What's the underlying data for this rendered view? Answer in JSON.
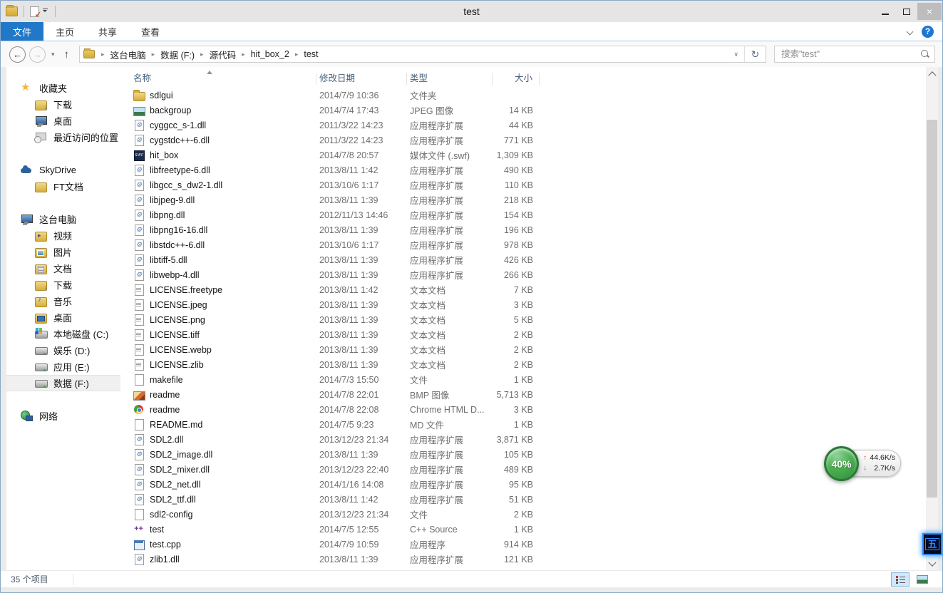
{
  "window": {
    "title": "test"
  },
  "icons": {
    "back": "←",
    "up": "↑",
    "refresh": "↻",
    "close": "×",
    "help": "?"
  },
  "ribbon": {
    "tabs": [
      {
        "key": "file",
        "label": "文件",
        "active": true
      },
      {
        "key": "home",
        "label": "主页",
        "active": false
      },
      {
        "key": "share",
        "label": "共享",
        "active": false
      },
      {
        "key": "view",
        "label": "查看",
        "active": false
      }
    ]
  },
  "address": {
    "breadcrumb": [
      "这台电脑",
      "数据 (F:)",
      "源代码",
      "hit_box_2",
      "test"
    ],
    "search_placeholder": "搜索\"test\""
  },
  "sidebar": {
    "groups": [
      {
        "key": "favorites",
        "label": "收藏夹",
        "icon": "star",
        "items": [
          {
            "label": "下载",
            "icon": "folder-down"
          },
          {
            "label": "桌面",
            "icon": "monitor"
          },
          {
            "label": "最近访问的位置",
            "icon": "recent"
          }
        ]
      },
      {
        "key": "skydrive",
        "label": "SkyDrive",
        "icon": "cloud",
        "items": [
          {
            "label": "FT文档",
            "icon": "folder"
          }
        ]
      },
      {
        "key": "thispc",
        "label": "这台电脑",
        "icon": "monitor",
        "items": [
          {
            "label": "视频",
            "icon": "folder-vid"
          },
          {
            "label": "图片",
            "icon": "folder-pic"
          },
          {
            "label": "文档",
            "icon": "folder-doc"
          },
          {
            "label": "下载",
            "icon": "folder-down"
          },
          {
            "label": "音乐",
            "icon": "folder-mus"
          },
          {
            "label": "桌面",
            "icon": "folder-desk"
          },
          {
            "label": "本地磁盘 (C:)",
            "icon": "disk-c"
          },
          {
            "label": "娱乐 (D:)",
            "icon": "disk"
          },
          {
            "label": "应用 (E:)",
            "icon": "disk"
          },
          {
            "label": "数据 (F:)",
            "icon": "disk",
            "selected": true
          }
        ]
      },
      {
        "key": "network",
        "label": "网络",
        "icon": "network",
        "items": []
      }
    ]
  },
  "filelist": {
    "columns": [
      {
        "key": "name",
        "label": "名称",
        "sorted": "asc"
      },
      {
        "key": "date",
        "label": "修改日期"
      },
      {
        "key": "type",
        "label": "类型"
      },
      {
        "key": "size",
        "label": "大小"
      }
    ],
    "rows": [
      {
        "name": "sdlgui",
        "date": "2014/7/9 10:36",
        "type": "文件夹",
        "size": "",
        "icon": "folder"
      },
      {
        "name": "backgroup",
        "date": "2014/7/4 17:43",
        "type": "JPEG 图像",
        "size": "14 KB",
        "icon": "jpeg"
      },
      {
        "name": "cyggcc_s-1.dll",
        "date": "2011/3/22 14:23",
        "type": "应用程序扩展",
        "size": "44 KB",
        "icon": "dll"
      },
      {
        "name": "cygstdc++-6.dll",
        "date": "2011/3/22 14:23",
        "type": "应用程序扩展",
        "size": "771 KB",
        "icon": "dll"
      },
      {
        "name": "hit_box",
        "date": "2014/7/8 20:57",
        "type": "媒体文件 (.swf)",
        "size": "1,309 KB",
        "icon": "swf"
      },
      {
        "name": "libfreetype-6.dll",
        "date": "2013/8/11 1:42",
        "type": "应用程序扩展",
        "size": "490 KB",
        "icon": "dll"
      },
      {
        "name": "libgcc_s_dw2-1.dll",
        "date": "2013/10/6 1:17",
        "type": "应用程序扩展",
        "size": "110 KB",
        "icon": "dll"
      },
      {
        "name": "libjpeg-9.dll",
        "date": "2013/8/11 1:39",
        "type": "应用程序扩展",
        "size": "218 KB",
        "icon": "dll"
      },
      {
        "name": "libpng.dll",
        "date": "2012/11/13 14:46",
        "type": "应用程序扩展",
        "size": "154 KB",
        "icon": "dll"
      },
      {
        "name": "libpng16-16.dll",
        "date": "2013/8/11 1:39",
        "type": "应用程序扩展",
        "size": "196 KB",
        "icon": "dll"
      },
      {
        "name": "libstdc++-6.dll",
        "date": "2013/10/6 1:17",
        "type": "应用程序扩展",
        "size": "978 KB",
        "icon": "dll"
      },
      {
        "name": "libtiff-5.dll",
        "date": "2013/8/11 1:39",
        "type": "应用程序扩展",
        "size": "426 KB",
        "icon": "dll"
      },
      {
        "name": "libwebp-4.dll",
        "date": "2013/8/11 1:39",
        "type": "应用程序扩展",
        "size": "266 KB",
        "icon": "dll"
      },
      {
        "name": "LICENSE.freetype",
        "date": "2013/8/11 1:42",
        "type": "文本文档",
        "size": "7 KB",
        "icon": "txt"
      },
      {
        "name": "LICENSE.jpeg",
        "date": "2013/8/11 1:39",
        "type": "文本文档",
        "size": "3 KB",
        "icon": "txt"
      },
      {
        "name": "LICENSE.png",
        "date": "2013/8/11 1:39",
        "type": "文本文档",
        "size": "5 KB",
        "icon": "txt"
      },
      {
        "name": "LICENSE.tiff",
        "date": "2013/8/11 1:39",
        "type": "文本文档",
        "size": "2 KB",
        "icon": "txt"
      },
      {
        "name": "LICENSE.webp",
        "date": "2013/8/11 1:39",
        "type": "文本文档",
        "size": "2 KB",
        "icon": "txt"
      },
      {
        "name": "LICENSE.zlib",
        "date": "2013/8/11 1:39",
        "type": "文本文档",
        "size": "2 KB",
        "icon": "txt"
      },
      {
        "name": "makefile",
        "date": "2014/7/3 15:50",
        "type": "文件",
        "size": "1 KB",
        "icon": "file"
      },
      {
        "name": "readme",
        "date": "2014/7/8 22:01",
        "type": "BMP 图像",
        "size": "5,713 KB",
        "icon": "bmp"
      },
      {
        "name": "readme",
        "date": "2014/7/8 22:08",
        "type": "Chrome HTML D...",
        "size": "3 KB",
        "icon": "chrome"
      },
      {
        "name": "README.md",
        "date": "2014/7/5 9:23",
        "type": "MD 文件",
        "size": "1 KB",
        "icon": "file"
      },
      {
        "name": "SDL2.dll",
        "date": "2013/12/23 21:34",
        "type": "应用程序扩展",
        "size": "3,871 KB",
        "icon": "dll"
      },
      {
        "name": "SDL2_image.dll",
        "date": "2013/8/11 1:39",
        "type": "应用程序扩展",
        "size": "105 KB",
        "icon": "dll"
      },
      {
        "name": "SDL2_mixer.dll",
        "date": "2013/12/23 22:40",
        "type": "应用程序扩展",
        "size": "489 KB",
        "icon": "dll"
      },
      {
        "name": "SDL2_net.dll",
        "date": "2014/1/16 14:08",
        "type": "应用程序扩展",
        "size": "95 KB",
        "icon": "dll"
      },
      {
        "name": "SDL2_ttf.dll",
        "date": "2013/8/11 1:42",
        "type": "应用程序扩展",
        "size": "51 KB",
        "icon": "dll"
      },
      {
        "name": "sdl2-config",
        "date": "2013/12/23 21:34",
        "type": "文件",
        "size": "2 KB",
        "icon": "file"
      },
      {
        "name": "test",
        "date": "2014/7/5 12:55",
        "type": "C++ Source",
        "size": "1 KB",
        "icon": "cpp"
      },
      {
        "name": "test.cpp",
        "date": "2014/7/9 10:59",
        "type": "应用程序",
        "size": "914 KB",
        "icon": "app"
      },
      {
        "name": "zlib1.dll",
        "date": "2013/8/11 1:39",
        "type": "应用程序扩展",
        "size": "121 KB",
        "icon": "dll"
      }
    ]
  },
  "statusbar": {
    "items_count": "35 个项目"
  },
  "overlay": {
    "percent": "40%",
    "upload": "44.6K/s",
    "download": "2.7K/s"
  },
  "ime": {
    "glyph": "五"
  }
}
